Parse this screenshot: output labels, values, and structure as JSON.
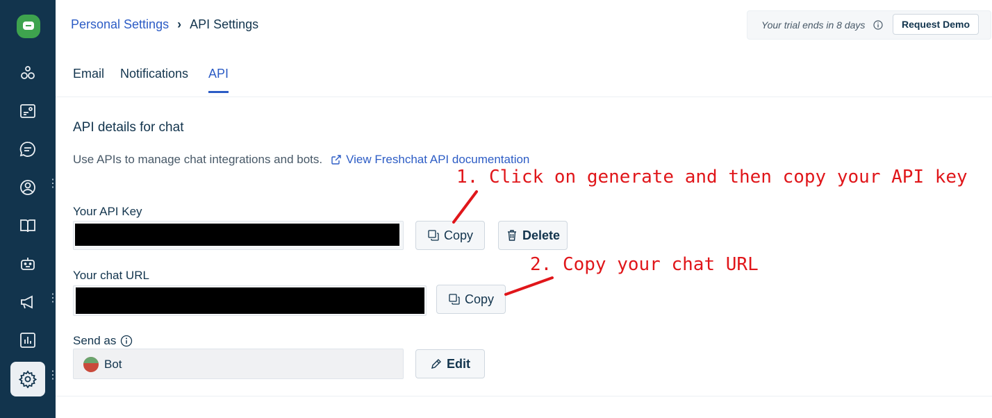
{
  "header": {
    "breadcrumb": {
      "parent": "Personal Settings",
      "current": "API Settings"
    },
    "trial": {
      "text": "Your trial ends in 8 days",
      "demo_label": "Request Demo"
    }
  },
  "sidebar": {
    "items": [
      {
        "icon": "network-icon"
      },
      {
        "icon": "tickets-icon"
      },
      {
        "icon": "conversations-icon"
      },
      {
        "icon": "contacts-icon",
        "has_more": true
      },
      {
        "icon": "knowledge-base-icon"
      },
      {
        "icon": "bot-icon"
      },
      {
        "icon": "campaigns-icon",
        "has_more": true
      },
      {
        "icon": "analytics-icon"
      },
      {
        "icon": "settings-icon",
        "has_more": true,
        "active": true
      }
    ]
  },
  "tabs": [
    {
      "label": "Email",
      "active": false
    },
    {
      "label": "Notifications",
      "active": false
    },
    {
      "label": "API",
      "active": true
    }
  ],
  "main": {
    "section_title": "API details for chat",
    "description": "Use APIs to manage chat integrations and bots.",
    "doc_link": "View Freshchat API documentation",
    "api_key": {
      "label": "Your API Key",
      "copy_label": "Copy",
      "delete_label": "Delete"
    },
    "chat_url": {
      "label": "Your chat URL",
      "copy_label": "Copy"
    },
    "send_as": {
      "label": "Send as",
      "value": "Bot",
      "edit_label": "Edit"
    }
  },
  "annotations": {
    "step1": "1. Click on generate and then copy your API key",
    "step2": "2. Copy your chat URL",
    "color": "#e0161a"
  },
  "colors": {
    "sidebar": "#12344d",
    "accent": "#2c5cc5",
    "logo": "#3ea34e"
  }
}
